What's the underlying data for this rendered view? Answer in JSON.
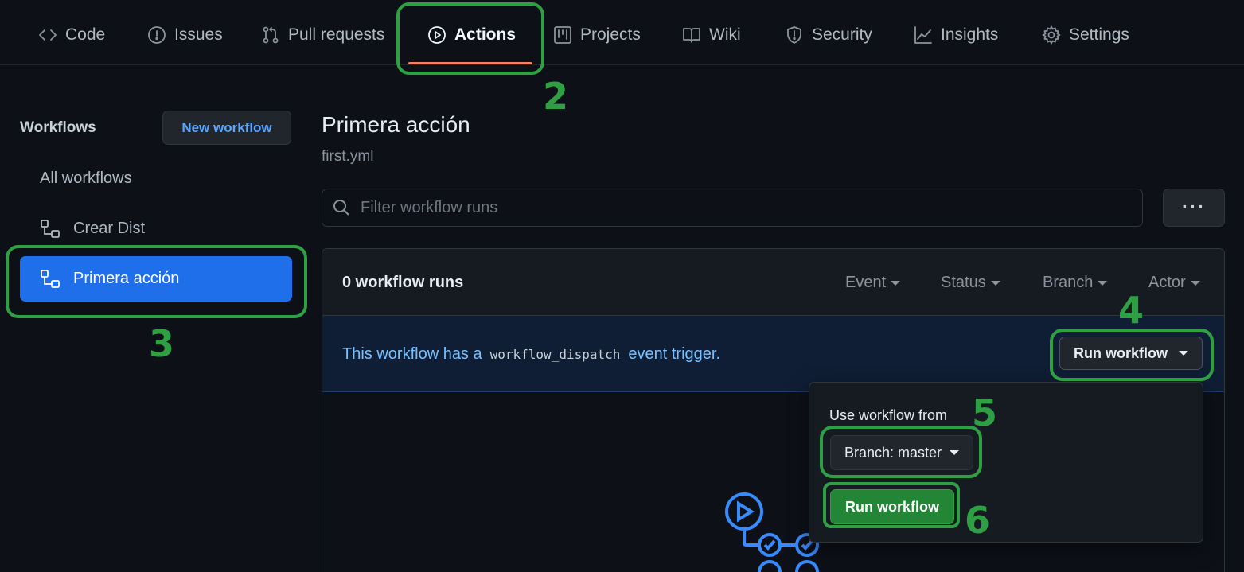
{
  "nav": {
    "tabs": [
      {
        "label": "Code",
        "icon": "code-icon"
      },
      {
        "label": "Issues",
        "icon": "issue-icon"
      },
      {
        "label": "Pull requests",
        "icon": "pull-request-icon"
      },
      {
        "label": "Actions",
        "icon": "play-icon",
        "active": true
      },
      {
        "label": "Projects",
        "icon": "project-icon"
      },
      {
        "label": "Wiki",
        "icon": "book-icon"
      },
      {
        "label": "Security",
        "icon": "shield-icon"
      },
      {
        "label": "Insights",
        "icon": "graph-icon"
      },
      {
        "label": "Settings",
        "icon": "gear-icon"
      }
    ]
  },
  "sidebar": {
    "title": "Workflows",
    "new_workflow_label": "New workflow",
    "items": [
      {
        "label": "All workflows"
      },
      {
        "label": "Crear Dist",
        "icon": "workflow-icon"
      },
      {
        "label": "Primera acción",
        "icon": "workflow-icon",
        "active": true
      }
    ]
  },
  "main": {
    "title": "Primera acción",
    "subtitle": "first.yml",
    "search_placeholder": "Filter workflow runs",
    "more_label": "···",
    "runs_count": "0 workflow runs",
    "filters": [
      "Event",
      "Status",
      "Branch",
      "Actor"
    ],
    "dispatch": {
      "prefix": "This workflow has a",
      "code": "workflow_dispatch",
      "suffix": "event trigger."
    },
    "run_workflow_label": "Run workflow"
  },
  "dropdown": {
    "label": "Use workflow from",
    "branch_label": "Branch: master",
    "run_label": "Run workflow"
  },
  "annotations": [
    "2",
    "3",
    "4",
    "5",
    "6"
  ],
  "colors": {
    "background": "#0d1117",
    "accent_blue": "#1f6feb",
    "link_blue": "#58a6ff",
    "annotation_green": "#2ea043",
    "tab_underline": "#f78166",
    "run_green": "#238636"
  }
}
